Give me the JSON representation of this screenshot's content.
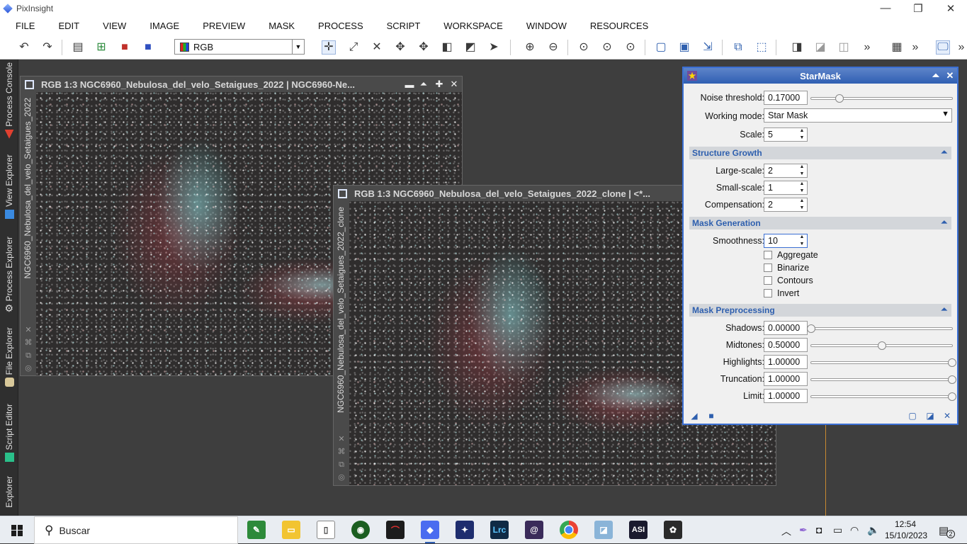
{
  "app": {
    "title": "PixInsight"
  },
  "window_controls": {
    "minimize": "—",
    "restore": "❐",
    "close": "✕"
  },
  "menu": [
    "FILE",
    "EDIT",
    "VIEW",
    "IMAGE",
    "PREVIEW",
    "MASK",
    "PROCESS",
    "SCRIPT",
    "WORKSPACE",
    "WINDOW",
    "RESOURCES"
  ],
  "toolbar": {
    "color_mode": "RGB",
    "overflow": "»"
  },
  "sidebar": {
    "tabs": [
      "Process Console",
      "View Explorer",
      "Process Explorer",
      "File Explorer",
      "Script Editor",
      "Explorer"
    ]
  },
  "image_windows": [
    {
      "title": "RGB 1:3 NGC6960_Nebulosa_del_velo_Setaigues_2022 | NGC6960-Ne...",
      "side_label": "NGC6960_Nebulosa_del_velo_Setaigues_2022"
    },
    {
      "title": "RGB 1:3 NGC6960_Nebulosa_del_velo_Setaigues_2022_clone | <*...",
      "side_label": "NGC6960_Nebulosa_del_velo_Setaigues_2022_clone"
    }
  ],
  "starmask": {
    "title": "StarMask",
    "noise_threshold": {
      "label": "Noise threshold:",
      "value": "0.17000",
      "slider": 0.2
    },
    "working_mode": {
      "label": "Working mode:",
      "value": "Star Mask"
    },
    "scale": {
      "label": "Scale:",
      "value": "5"
    },
    "structure_growth": {
      "title": "Structure Growth",
      "large_scale": {
        "label": "Large-scale:",
        "value": "2"
      },
      "small_scale": {
        "label": "Small-scale:",
        "value": "1"
      },
      "compensation": {
        "label": "Compensation:",
        "value": "2"
      }
    },
    "mask_generation": {
      "title": "Mask Generation",
      "smoothness": {
        "label": "Smoothness:",
        "value": "10"
      },
      "aggregate": {
        "label": "Aggregate",
        "checked": false
      },
      "binarize": {
        "label": "Binarize",
        "checked": false
      },
      "contours": {
        "label": "Contours",
        "checked": false
      },
      "invert": {
        "label": "Invert",
        "checked": false
      }
    },
    "mask_preprocessing": {
      "title": "Mask Preprocessing",
      "shadows": {
        "label": "Shadows:",
        "value": "0.00000",
        "slider": 0.0
      },
      "midtones": {
        "label": "Midtones:",
        "value": "0.50000",
        "slider": 0.5
      },
      "highlights": {
        "label": "Highlights:",
        "value": "1.00000",
        "slider": 1.0
      },
      "truncation": {
        "label": "Truncation:",
        "value": "1.00000",
        "slider": 1.0
      },
      "limit": {
        "label": "Limit:",
        "value": "1.00000",
        "slider": 1.0
      }
    }
  },
  "taskbar": {
    "search_placeholder": "Buscar",
    "time": "12:54",
    "date": "15/10/2023",
    "notifications": "2",
    "apps": [
      "Lrc",
      "ASI"
    ]
  }
}
